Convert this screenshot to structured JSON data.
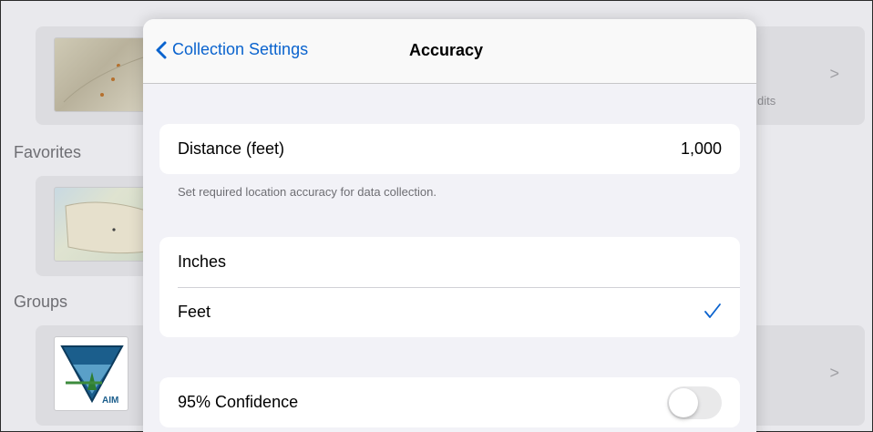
{
  "background": {
    "sections": {
      "favorites": "Favorites",
      "groups": "Groups"
    },
    "partial_text": "dits",
    "group_logo_text": "AIM"
  },
  "navbar": {
    "back_label": "Collection Settings",
    "title": "Accuracy"
  },
  "distance": {
    "label": "Distance (feet)",
    "value": "1,000",
    "footnote": "Set required location accuracy for data collection."
  },
  "units": {
    "options": [
      "Inches",
      "Feet"
    ],
    "selected": "Feet",
    "checkmark": "✓"
  },
  "confidence": {
    "label": "95% Confidence",
    "enabled": false
  },
  "colors": {
    "accent": "#0a63ce",
    "background": "#f2f2f7"
  }
}
